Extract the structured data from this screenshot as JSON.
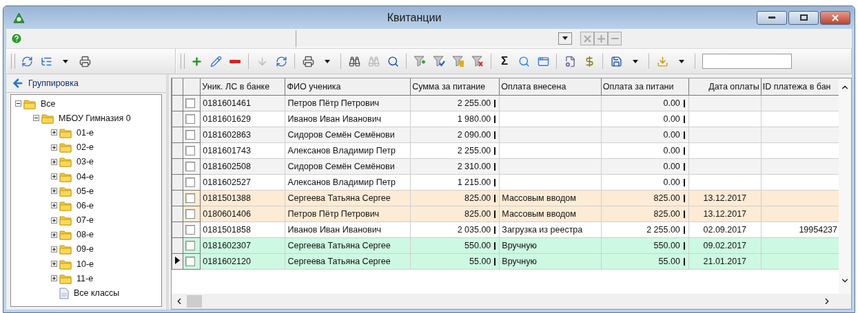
{
  "window": {
    "title": "Квитанции"
  },
  "combo_buttons": [
    {
      "kind": "clear",
      "disabled": true
    },
    {
      "kind": "add",
      "disabled": true
    },
    {
      "kind": "remove",
      "disabled": true
    }
  ],
  "left_toolbar": [
    {
      "kind": "refresh",
      "disabled": false
    },
    {
      "kind": "tree",
      "disabled": false
    },
    {
      "kind": "caret",
      "disabled": false
    },
    {
      "kind": "print",
      "disabled": false
    }
  ],
  "toolbar": [
    {
      "kind": "add",
      "disabled": false
    },
    {
      "kind": "edit",
      "disabled": false
    },
    {
      "kind": "delete",
      "disabled": false
    },
    {
      "kind": "separator"
    },
    {
      "kind": "move-down",
      "disabled": true
    },
    {
      "kind": "refresh",
      "disabled": false
    },
    {
      "kind": "separator"
    },
    {
      "kind": "print",
      "disabled": false
    },
    {
      "kind": "caret",
      "disabled": false
    },
    {
      "kind": "separator"
    },
    {
      "kind": "find",
      "disabled": false
    },
    {
      "kind": "find-next",
      "disabled": true
    },
    {
      "kind": "find-window",
      "disabled": false
    },
    {
      "kind": "separator"
    },
    {
      "kind": "filter-add",
      "disabled": false
    },
    {
      "kind": "filter-check",
      "disabled": false
    },
    {
      "kind": "filter-list",
      "disabled": false
    },
    {
      "kind": "filter-remove",
      "disabled": false
    },
    {
      "kind": "separator"
    },
    {
      "kind": "sum",
      "label": "Σ",
      "disabled": false
    },
    {
      "kind": "preview",
      "disabled": false
    },
    {
      "kind": "window",
      "disabled": false
    },
    {
      "kind": "separator"
    },
    {
      "kind": "document-settings",
      "disabled": false
    },
    {
      "kind": "payment",
      "disabled": false
    },
    {
      "kind": "separator"
    },
    {
      "kind": "save",
      "disabled": false
    },
    {
      "kind": "caret",
      "disabled": false
    },
    {
      "kind": "separator"
    },
    {
      "kind": "import",
      "disabled": false
    },
    {
      "kind": "caret",
      "disabled": false
    },
    {
      "kind": "separator"
    }
  ],
  "grouping": {
    "title": "Группировка"
  },
  "tree": [
    {
      "label": "Все",
      "kind": "folder",
      "expanded": true,
      "children": [
        {
          "label": "МБОУ Гимназия 0",
          "kind": "folder",
          "expanded": true,
          "children": [
            {
              "label": "01-е",
              "kind": "folder",
              "expanded": false
            },
            {
              "label": "02-е",
              "kind": "folder",
              "expanded": false
            },
            {
              "label": "03-е",
              "kind": "folder",
              "expanded": false
            },
            {
              "label": "04-е",
              "kind": "folder",
              "expanded": false
            },
            {
              "label": "05-е",
              "kind": "folder",
              "expanded": false
            },
            {
              "label": "06-е",
              "kind": "folder",
              "expanded": false
            },
            {
              "label": "07-е",
              "kind": "folder",
              "expanded": false
            },
            {
              "label": "08-е",
              "kind": "folder",
              "expanded": false
            },
            {
              "label": "09-е",
              "kind": "folder",
              "expanded": false
            },
            {
              "label": "10-е",
              "kind": "folder",
              "expanded": false
            },
            {
              "label": "11-е",
              "kind": "folder",
              "expanded": false
            },
            {
              "label": "Все классы",
              "kind": "document"
            }
          ]
        }
      ]
    }
  ],
  "table": {
    "columns": [
      {
        "label": "Уник. ЛС в банке"
      },
      {
        "label": "ФИО ученика"
      },
      {
        "label": "Сумма за питание"
      },
      {
        "label": "Оплата внесена"
      },
      {
        "label": "Оплата за питани"
      },
      {
        "label": "Дата оплаты"
      },
      {
        "label": "ID платежа в бан"
      }
    ],
    "rows": [
      {
        "current": false,
        "checked": false,
        "color": "#f3f3f3",
        "cells": [
          "0181601461",
          "Петров Пётр Петрович",
          "2 255.00",
          "",
          "0.00",
          "",
          ""
        ]
      },
      {
        "current": false,
        "checked": false,
        "color": "#ffffff",
        "cells": [
          "0181601629",
          "Иванов Иван Иванович",
          "1 980.00",
          "",
          "0.00",
          "",
          ""
        ]
      },
      {
        "current": false,
        "checked": false,
        "color": "#f3f3f3",
        "cells": [
          "0181602863",
          "Сидоров Семён Семёнови",
          "2 090.00",
          "",
          "0.00",
          "",
          ""
        ]
      },
      {
        "current": false,
        "checked": false,
        "color": "#ffffff",
        "cells": [
          "0181601743",
          "Алексанов Владимир Петр",
          "2 255.00",
          "",
          "0.00",
          "",
          ""
        ]
      },
      {
        "current": false,
        "checked": false,
        "color": "#f3f3f3",
        "cells": [
          "0181602508",
          "Сидоров Семён Семёнови",
          "2 310.00",
          "",
          "0.00",
          "",
          ""
        ]
      },
      {
        "current": false,
        "checked": false,
        "color": "#ffffff",
        "cells": [
          "0181602527",
          "Алексанов Владимир Петр",
          "1 215.00",
          "",
          "0.00",
          "",
          ""
        ]
      },
      {
        "current": false,
        "checked": false,
        "color": "#fdebd5",
        "cells": [
          "0181501388",
          "Сергеева Татьяна Сергее",
          "825.00",
          "Массовым вводом",
          "825.00",
          "13.12.2017",
          ""
        ]
      },
      {
        "current": false,
        "checked": false,
        "color": "#fdebd5",
        "cells": [
          "0180601406",
          "Петров Пётр Петрович",
          "825.00",
          "Массовым вводом",
          "825.00",
          "13.12.2017",
          ""
        ]
      },
      {
        "current": false,
        "checked": false,
        "color": "#ffffff",
        "cells": [
          "0181501858",
          "Иванов Иван Иванович",
          "2 035.00",
          "Загрузка из реестра",
          "2 255.00",
          "02.09.2017",
          "19954237"
        ]
      },
      {
        "current": false,
        "checked": false,
        "color": "#cdf8e2",
        "cells": [
          "0181602307",
          "Сергеева Татьяна Сергее",
          "550.00",
          "Вручную",
          "550.00",
          "09.02.2017",
          ""
        ]
      },
      {
        "current": true,
        "checked": false,
        "color": "#cdf8e2",
        "cells": [
          "0181602120",
          "Сергеева Татьяна Сергее",
          "55.00",
          "Вручную",
          "55.00",
          "21.01.2017",
          ""
        ]
      }
    ]
  }
}
